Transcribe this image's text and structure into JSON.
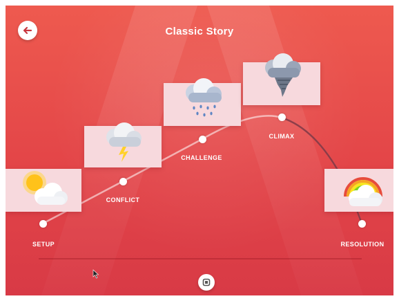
{
  "header": {
    "title": "Classic Story",
    "back_icon": "back-arrow-icon"
  },
  "stages": [
    {
      "label": "SETUP",
      "weather_icon": "sun-behind-cloud-icon"
    },
    {
      "label": "CONFLICT",
      "weather_icon": "cloud-lightning-icon"
    },
    {
      "label": "CHALLENGE",
      "weather_icon": "cloud-rain-icon"
    },
    {
      "label": "CLIMAX",
      "weather_icon": "tornado-cloud-icon"
    },
    {
      "label": "RESOLUTION",
      "weather_icon": "rainbow-cloud-icon"
    }
  ],
  "footer": {
    "button_icon": "square-stop-icon"
  },
  "colors": {
    "background": "#e34548",
    "card": "#f7d9dd",
    "text": "#ffffff"
  }
}
